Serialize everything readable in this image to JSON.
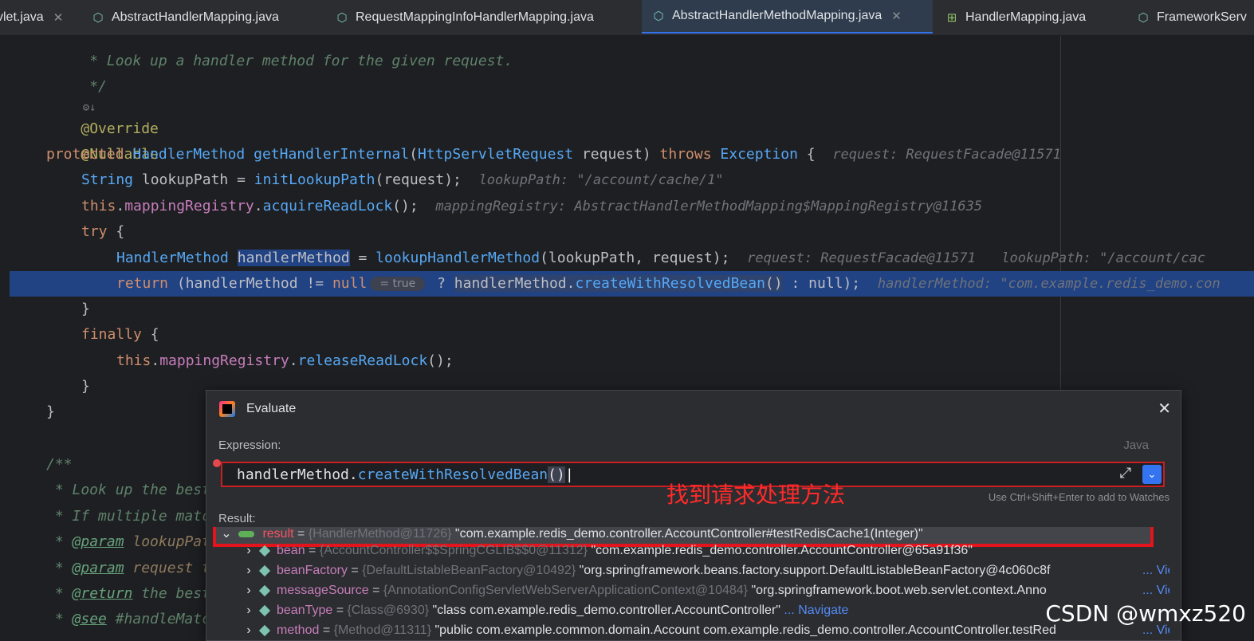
{
  "tabs": [
    {
      "label": "vlet.java",
      "active": false,
      "closable": true,
      "icon": "java-file-icon"
    },
    {
      "label": "AbstractHandlerMapping.java",
      "active": false,
      "closable": false,
      "icon": "java-class-icon"
    },
    {
      "label": "RequestMappingInfoHandlerMapping.java",
      "active": false,
      "closable": false,
      "icon": "java-class-icon"
    },
    {
      "label": "AbstractHandlerMethodMapping.java",
      "active": true,
      "closable": true,
      "icon": "java-class-icon"
    },
    {
      "label": "HandlerMapping.java",
      "active": false,
      "closable": false,
      "icon": "java-interface-icon"
    },
    {
      "label": "FrameworkServ",
      "active": false,
      "closable": false,
      "icon": "java-class-icon"
    }
  ],
  "code": {
    "l0": " * Look up a handler method for the given request.",
    "l1": " */",
    "l2_marks": "⚙↓",
    "l3": "@Override",
    "l4": "@Nullable",
    "l5": {
      "kw": "protected",
      "type": "HandlerMethod",
      "fn": "getHandlerInternal",
      "p1": "HttpServletRequest",
      "p2": "request",
      "kw2": "throws",
      "exc": "Exception",
      "brace": "{",
      "hint": "request: RequestFacade@11571"
    },
    "l6": {
      "type": "String",
      "var": "lookupPath",
      "eq": "=",
      "fn": "initLookupPath",
      "arg": "(request);",
      "hint": "lookupPath: \"/account/cache/1\""
    },
    "l7": {
      "kw": "this",
      "fld": "mappingRegistry",
      "fn": "acquireReadLock",
      "end": "();",
      "hint": "mappingRegistry: AbstractHandlerMethodMapping$MappingRegistry@11635"
    },
    "l8": {
      "kw": "try",
      "brace": "{"
    },
    "l9": {
      "type": "HandlerMethod",
      "var": "handlerMethod",
      "eq": "=",
      "fn": "lookupHandlerMethod",
      "args": "(lookupPath, request);",
      "hint1": "request: RequestFacade@11571",
      "hint2": "lookupPath: \"/account/cac"
    },
    "l10": {
      "kw": "return",
      "p1": "(handlerMethod != ",
      "kw2": "null",
      "badge": "= true",
      "q": "?",
      "var": "handlerMethod",
      "fn": "createWithResolvedBean",
      "end": "()",
      "tail": ": null);",
      "hint": "handlerMethod: \"com.example.redis_demo.con"
    },
    "l11": "}",
    "l12": {
      "kw": "finally",
      "brace": "{"
    },
    "l13": {
      "kw": "this",
      "fld": "mappingRegistry",
      "fn": "releaseReadLock",
      "end": "();"
    },
    "l14": "}",
    "l15": "}",
    "l16": "/**",
    "l17": " * Look up the best",
    "l18": " * If multiple matc",
    "l19": {
      "star": " * ",
      "tag": "@param",
      "rest": " lookupPat"
    },
    "l20": {
      "star": " * ",
      "tag": "@param",
      "rest": " request t"
    },
    "l21": {
      "star": " * ",
      "tag": "@return",
      "rest": " the best"
    },
    "l22": {
      "star": " * ",
      "tag": "@see",
      "rest": " #handleMatc"
    }
  },
  "dialog": {
    "title": "Evaluate",
    "expression_label": "Expression:",
    "language": "Java",
    "expression_var": "handlerMethod",
    "expression_fn": "createWithResolvedBean",
    "expression_end": "()",
    "add_to_watches_hint": "Use Ctrl+Shift+Enter to add to Watches",
    "annotation": "找到请求处理方法",
    "result_label": "Result:",
    "result": {
      "name": "result",
      "type": "{HandlerMethod@11726}",
      "value": "\"com.example.redis_demo.controller.AccountController#testRedisCache1(Integer)\""
    },
    "children": [
      {
        "name": "bean",
        "type": "{AccountController$$SpringCGLIB$$0@11312}",
        "value": "\"com.example.redis_demo.controller.AccountController@65a91f36\"",
        "link": ""
      },
      {
        "name": "beanFactory",
        "type": "{DefaultListableBeanFactory@10492}",
        "value": "\"org.springframework.beans.factory.support.DefaultListableBeanFactory@4c060c8f",
        "link": "... View"
      },
      {
        "name": "messageSource",
        "type": "{AnnotationConfigServletWebServerApplicationContext@10484}",
        "value": "\"org.springframework.boot.web.servlet.context.Anno",
        "link": "... View"
      },
      {
        "name": "beanType",
        "type": "{Class@6930}",
        "value": "\"class com.example.redis_demo.controller.AccountController\"",
        "link": "... Navigate"
      },
      {
        "name": "method",
        "type": "{Method@11311}",
        "value": "\"public com.example.common.domain.Account com.example.redis_demo.controller.AccountController.testRed",
        "link": "... View"
      }
    ]
  },
  "watermark": "CSDN @wmxz520"
}
